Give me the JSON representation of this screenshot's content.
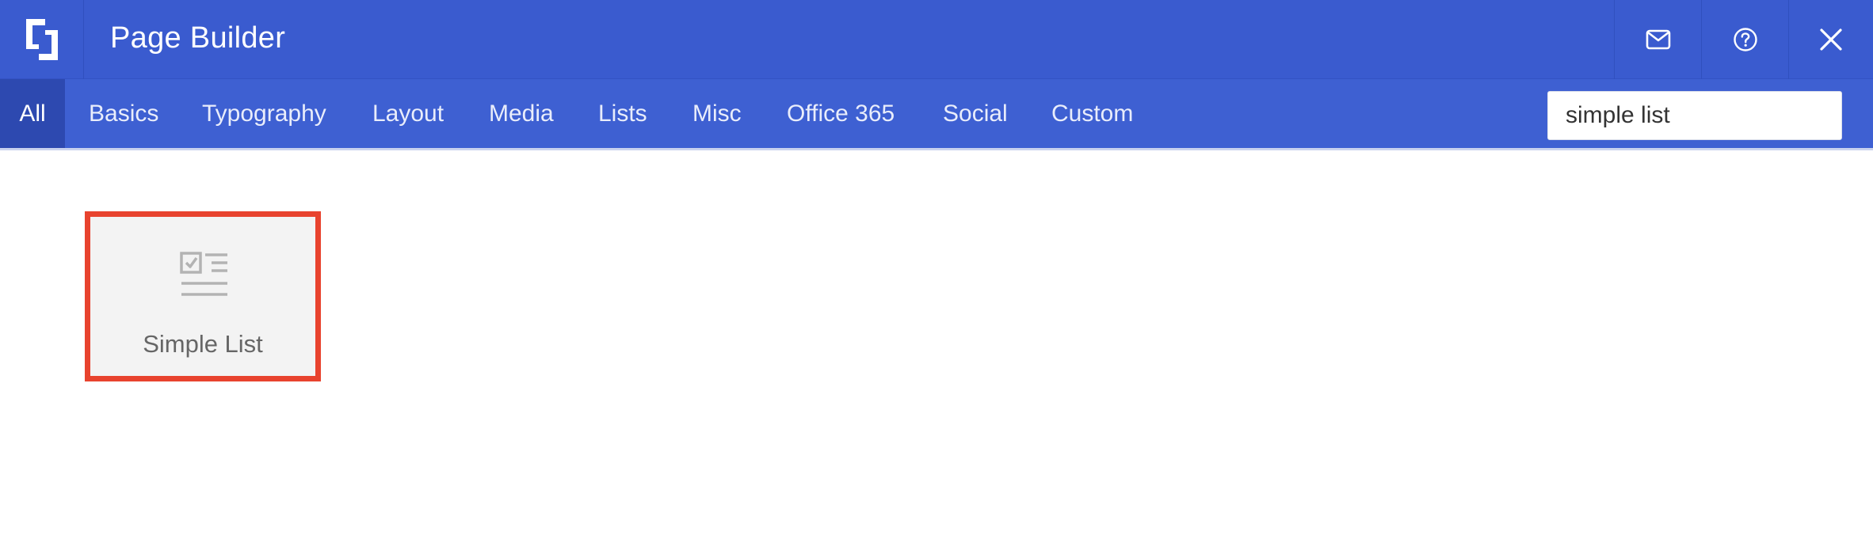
{
  "header": {
    "title": "Page Builder",
    "logo_icon": "page-builder-logo-icon",
    "actions": [
      {
        "name": "mail-button",
        "icon": "mail-icon"
      },
      {
        "name": "help-button",
        "icon": "question-circle-icon"
      },
      {
        "name": "close-button",
        "icon": "close-icon"
      }
    ]
  },
  "tabs": [
    {
      "label": "All",
      "active": true
    },
    {
      "label": "Basics"
    },
    {
      "label": "Typography"
    },
    {
      "label": "Layout"
    },
    {
      "label": "Media"
    },
    {
      "label": "Lists"
    },
    {
      "label": "Misc"
    },
    {
      "label": "Office 365"
    },
    {
      "label": "Social"
    },
    {
      "label": "Custom"
    }
  ],
  "search": {
    "value": "simple list",
    "placeholder": ""
  },
  "results": [
    {
      "label": "Simple List",
      "icon": "checklist-icon",
      "highlighted": true
    }
  ],
  "colors": {
    "header_bg": "#3a5bcf",
    "tabbar_bg": "#3e60d2",
    "active_tab_bg": "#2d49b0",
    "highlight_border": "#e8432e",
    "card_bg": "#f3f3f3"
  }
}
